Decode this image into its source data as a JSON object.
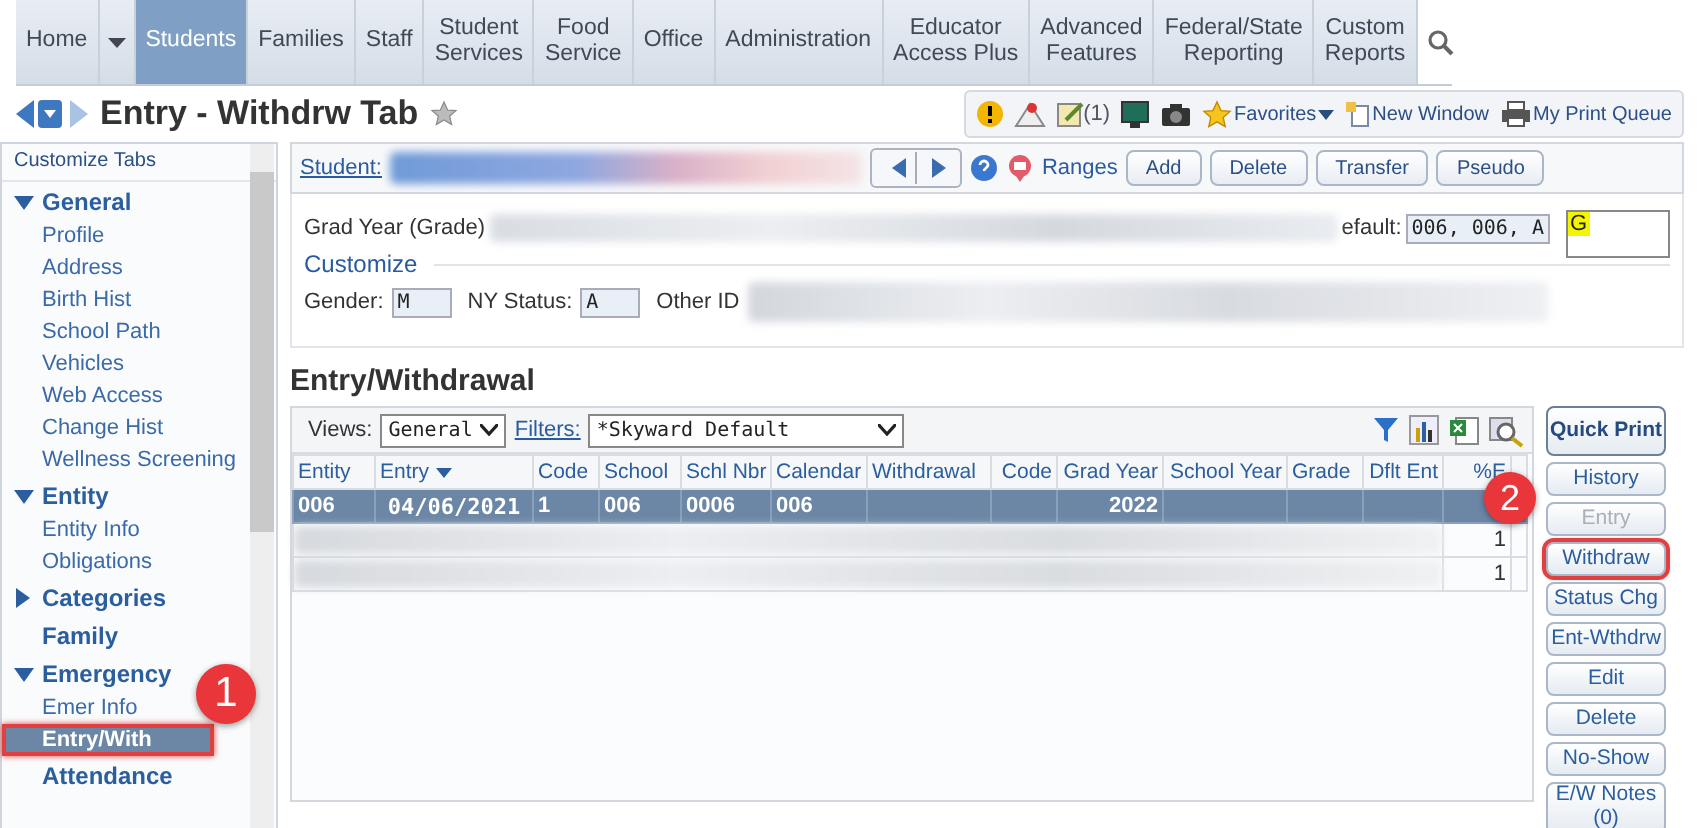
{
  "nav": {
    "tabs": [
      {
        "label": "Home",
        "selected": false
      },
      {
        "label": "Students",
        "selected": true
      },
      {
        "label": "Families",
        "selected": false
      },
      {
        "label": "Staff",
        "selected": false
      },
      {
        "label": "Student\nServices",
        "selected": false
      },
      {
        "label": "Food\nService",
        "selected": false
      },
      {
        "label": "Office",
        "selected": false
      },
      {
        "label": "Administration",
        "selected": false
      },
      {
        "label": "Educator\nAccess Plus",
        "selected": false
      },
      {
        "label": "Advanced\nFeatures",
        "selected": false
      },
      {
        "label": "Federal/State\nReporting",
        "selected": false
      },
      {
        "label": "Custom\nReports",
        "selected": false
      }
    ]
  },
  "title": "Entry - Withdrw Tab",
  "toolbar": {
    "message_count": "(1)",
    "favorites": "Favorites",
    "new_window": "New Window",
    "print_queue": "My Print Queue"
  },
  "sidebar": {
    "header": "Customize Tabs",
    "groups": [
      {
        "label": "General",
        "kind": "group",
        "expanded": true,
        "children": [
          {
            "label": "Profile",
            "selected": false,
            "highlighted": false
          },
          {
            "label": "Address",
            "selected": false,
            "highlighted": false
          },
          {
            "label": "Birth Hist",
            "selected": false,
            "highlighted": false
          },
          {
            "label": "School Path",
            "selected": false,
            "highlighted": false
          },
          {
            "label": "Vehicles",
            "selected": false,
            "highlighted": false
          },
          {
            "label": "Web Access",
            "selected": false,
            "highlighted": false
          },
          {
            "label": "Change Hist",
            "selected": false,
            "highlighted": false
          },
          {
            "label": "Wellness Screening",
            "selected": false,
            "highlighted": false
          }
        ]
      },
      {
        "label": "Entity",
        "kind": "group",
        "expanded": true,
        "children": [
          {
            "label": "Entity Info",
            "selected": false,
            "highlighted": false
          },
          {
            "label": "Obligations",
            "selected": false,
            "highlighted": false
          }
        ]
      },
      {
        "label": "Categories",
        "kind": "group",
        "expanded": false
      },
      {
        "label": "Family",
        "kind": "single"
      },
      {
        "label": "Emergency",
        "kind": "group",
        "expanded": true,
        "children": [
          {
            "label": "Emer Info",
            "selected": false,
            "highlighted": false
          },
          {
            "label": "Entry/With",
            "selected": true,
            "highlighted": true
          }
        ]
      },
      {
        "label": "Attendance",
        "kind": "single"
      }
    ]
  },
  "student_bar": {
    "label": "Student:",
    "ranges": "Ranges",
    "buttons": [
      "Add",
      "Delete",
      "Transfer",
      "Pseudo"
    ]
  },
  "info": {
    "grad_year_label": "Grad Year (Grade)",
    "default_label": "efault:",
    "default_value": "006, 006, A",
    "grade_box": "G",
    "customize": "Customize",
    "gender_label": "Gender:",
    "gender": "M",
    "status_label": "NY Status:",
    "status": "A",
    "other_id_label": "Other ID"
  },
  "section_title": "Entry/Withdrawal",
  "grid": {
    "views_label": "Views:",
    "view": "General",
    "filters_label": "Filters:",
    "filter": "*Skyward Default",
    "columns": [
      "Entity",
      "Entry",
      "Code",
      "School",
      "Schl Nbr",
      "Calendar",
      "Withdrawal",
      "Code",
      "Grad Year",
      "School Year",
      "Grade",
      "Dflt Ent",
      "%E"
    ],
    "rows": [
      {
        "kind": "data",
        "selected": true,
        "cells": [
          "006",
          "04/06/2021",
          "1",
          "006",
          "0006",
          "006",
          "",
          "",
          "2022",
          "",
          "",
          "",
          ""
        ]
      },
      {
        "kind": "redacted",
        "selected": false,
        "last": "1"
      },
      {
        "kind": "redacted",
        "selected": false,
        "last": "1"
      }
    ]
  },
  "side_buttons": [
    {
      "label": "Quick Print",
      "disabled": false,
      "highlighted": false
    },
    {
      "label": "History",
      "disabled": false,
      "highlighted": false
    },
    {
      "label": "Entry",
      "disabled": true,
      "highlighted": false
    },
    {
      "label": "Withdraw",
      "disabled": false,
      "highlighted": true
    },
    {
      "label": "Status Chg",
      "disabled": false,
      "highlighted": false
    },
    {
      "label": "Ent-Wthdrw",
      "disabled": false,
      "highlighted": false
    },
    {
      "label": "Edit",
      "disabled": false,
      "highlighted": false
    },
    {
      "label": "Delete",
      "disabled": false,
      "highlighted": false
    },
    {
      "label": "No-Show",
      "disabled": false,
      "highlighted": false
    },
    {
      "label": "E/W Notes\n(0)",
      "disabled": false,
      "highlighted": false
    }
  ],
  "annotations": [
    "1",
    "2"
  ]
}
